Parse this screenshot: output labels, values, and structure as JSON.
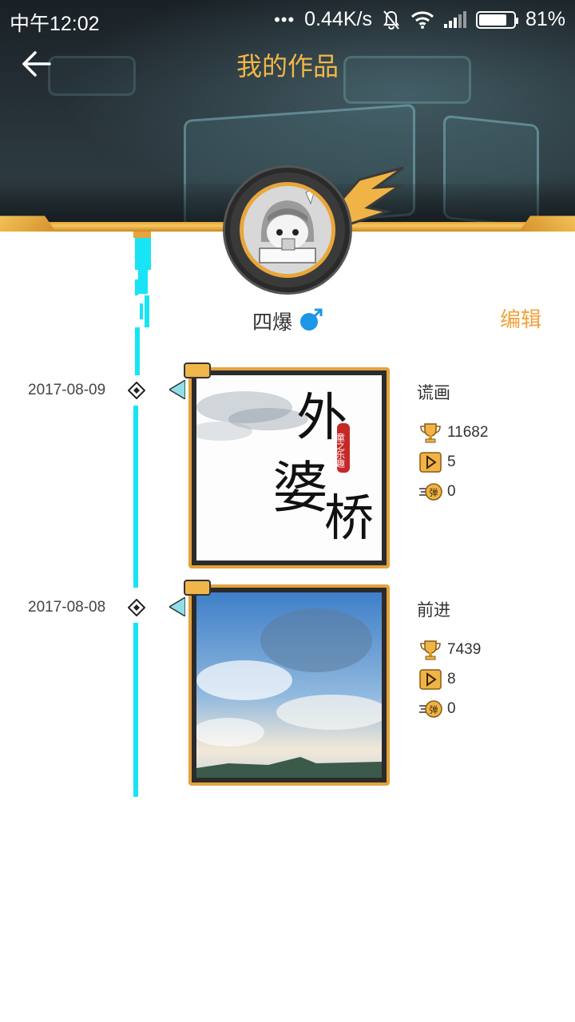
{
  "status_bar": {
    "time": "中午12:02",
    "network_speed": "0.44K/s",
    "battery": "81%",
    "battery_level": 0.81
  },
  "header": {
    "title": "我的作品"
  },
  "user": {
    "name": "四爆",
    "edit_label": "编辑"
  },
  "colors": {
    "accent": "#f2a13b",
    "timeline": "#18e4f5",
    "frame": "#e2a33c",
    "gender": "#1e96e8"
  },
  "works": [
    {
      "date": "2017-08-09",
      "title": "谎画",
      "trophies": "11682",
      "plays": "5",
      "danmaku": "0",
      "cover_text": [
        "外",
        "婆",
        "桥"
      ],
      "cover_seal": "童之乐趣"
    },
    {
      "date": "2017-08-08",
      "title": "前进",
      "trophies": "7439",
      "plays": "8",
      "danmaku": "0"
    }
  ]
}
